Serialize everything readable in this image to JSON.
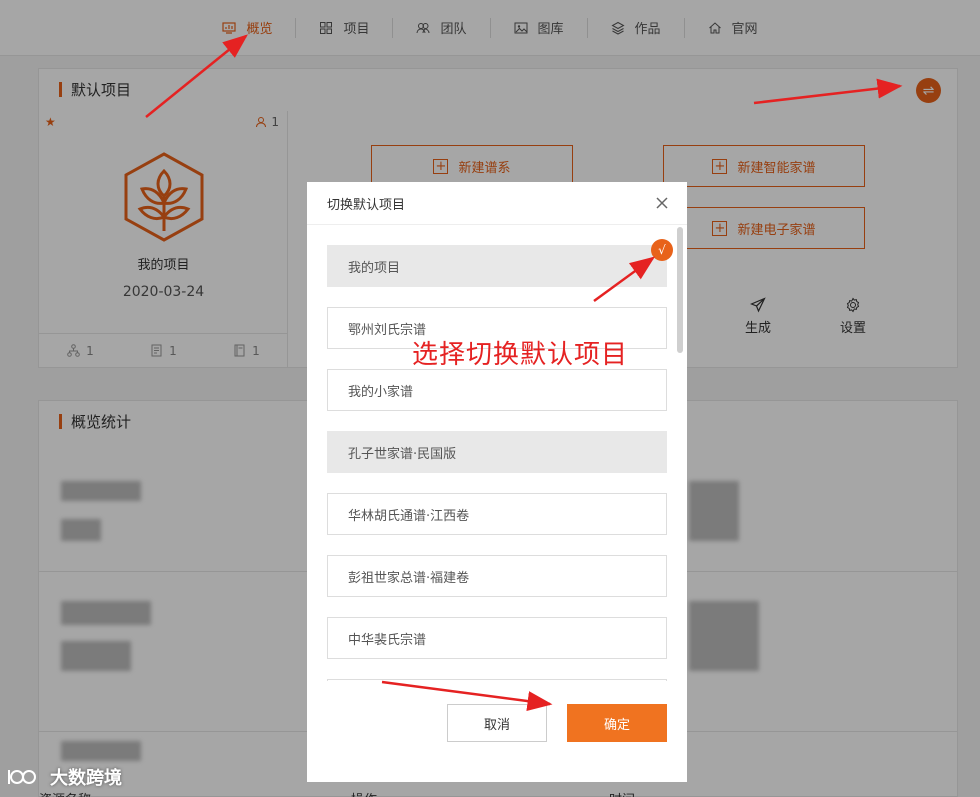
{
  "nav": {
    "items": [
      {
        "label": "概览",
        "icon": "dashboard-icon",
        "active": true
      },
      {
        "label": "项目",
        "icon": "grid-icon",
        "active": false
      },
      {
        "label": "团队",
        "icon": "team-icon",
        "active": false
      },
      {
        "label": "图库",
        "icon": "image-icon",
        "active": false
      },
      {
        "label": "作品",
        "icon": "layers-icon",
        "active": false
      },
      {
        "label": "官网",
        "icon": "home-icon",
        "active": false
      }
    ]
  },
  "default_project": {
    "title": "默认项目",
    "switch_icon": "⇌",
    "card": {
      "star": "★",
      "member_count": "1",
      "name": "我的项目",
      "date": "2020-03-24",
      "footer": [
        {
          "icon": "branch-icon",
          "count": "1"
        },
        {
          "icon": "document-icon",
          "count": "1"
        },
        {
          "icon": "book-icon",
          "count": "1"
        }
      ]
    },
    "actions": {
      "new_lineage": "新建谱系",
      "new_smart_genealogy": "新建智能家谱",
      "new_ebook_genealogy": "新建电子家谱"
    },
    "tools": {
      "generate": "生成",
      "settings": "设置"
    }
  },
  "stats": {
    "title": "概览统计",
    "table_headers": [
      "资源名称",
      "操作",
      "时间"
    ]
  },
  "modal": {
    "title": "切换默认项目",
    "items": [
      "我的项目",
      "鄂州刘氏宗谱",
      "我的小家谱",
      "孔子世家谱·民国版",
      "华林胡氏通谱·江西卷",
      "彭祖世家总谱·福建卷",
      "中华裴氏宗谱"
    ],
    "selected_mark": "√",
    "cancel_label": "取消",
    "confirm_label": "确定"
  },
  "annotation": "选择切换默认项目",
  "watermark": "大数跨境",
  "colors": {
    "accent": "#e8621a",
    "confirm_button": "#f07320",
    "annotation": "#e52222"
  }
}
